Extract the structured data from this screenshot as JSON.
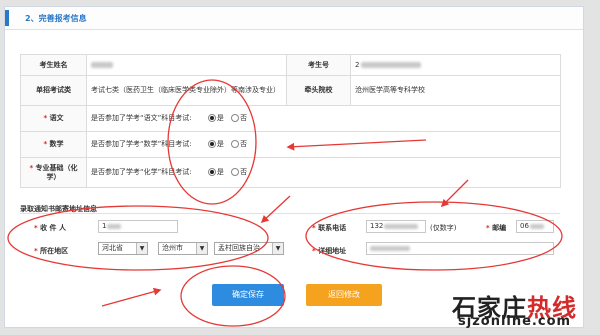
{
  "section": {
    "title": "2、完善报考信息"
  },
  "row1": {
    "name_label": "考生姓名",
    "no_label": "考生号",
    "no_value_prefix": "2"
  },
  "row2": {
    "label": "单招考试类",
    "value": "考试七类（医药卫生（临床医学类专业除外）等南涉及专业）",
    "school_label": "牵头院校",
    "school_value": "沧州医学高等专科学校"
  },
  "rows": [
    {
      "label": "语文",
      "question": "是否参加了学考“语文”科目考试:"
    },
    {
      "label": "数学",
      "question": "是否参加了学考“数学”科目考试:"
    },
    {
      "label": "专业基础（化学）",
      "question": "是否参加了学考“化学”科目考试:"
    }
  ],
  "radio": {
    "yes": "是",
    "no": "否"
  },
  "address": {
    "title": "录取通知书邮寄地址信息",
    "recipient_label": "收 件 人",
    "recipient_value": "1",
    "phone_label": "联系电话",
    "phone_value": "132",
    "phone_hint": "(仅数字)",
    "zip_label": "邮编",
    "zip_value": "06",
    "region_label": "所在地区",
    "province": "河北省",
    "city": "沧州市",
    "county": "孟村回族自治",
    "detail_label": "详细地址"
  },
  "buttons": {
    "save": "确定保存",
    "back": "返回修改"
  },
  "watermark": {
    "line1_a": "石家庄",
    "line1_b": "热线",
    "line2": "sjzonline.com"
  }
}
